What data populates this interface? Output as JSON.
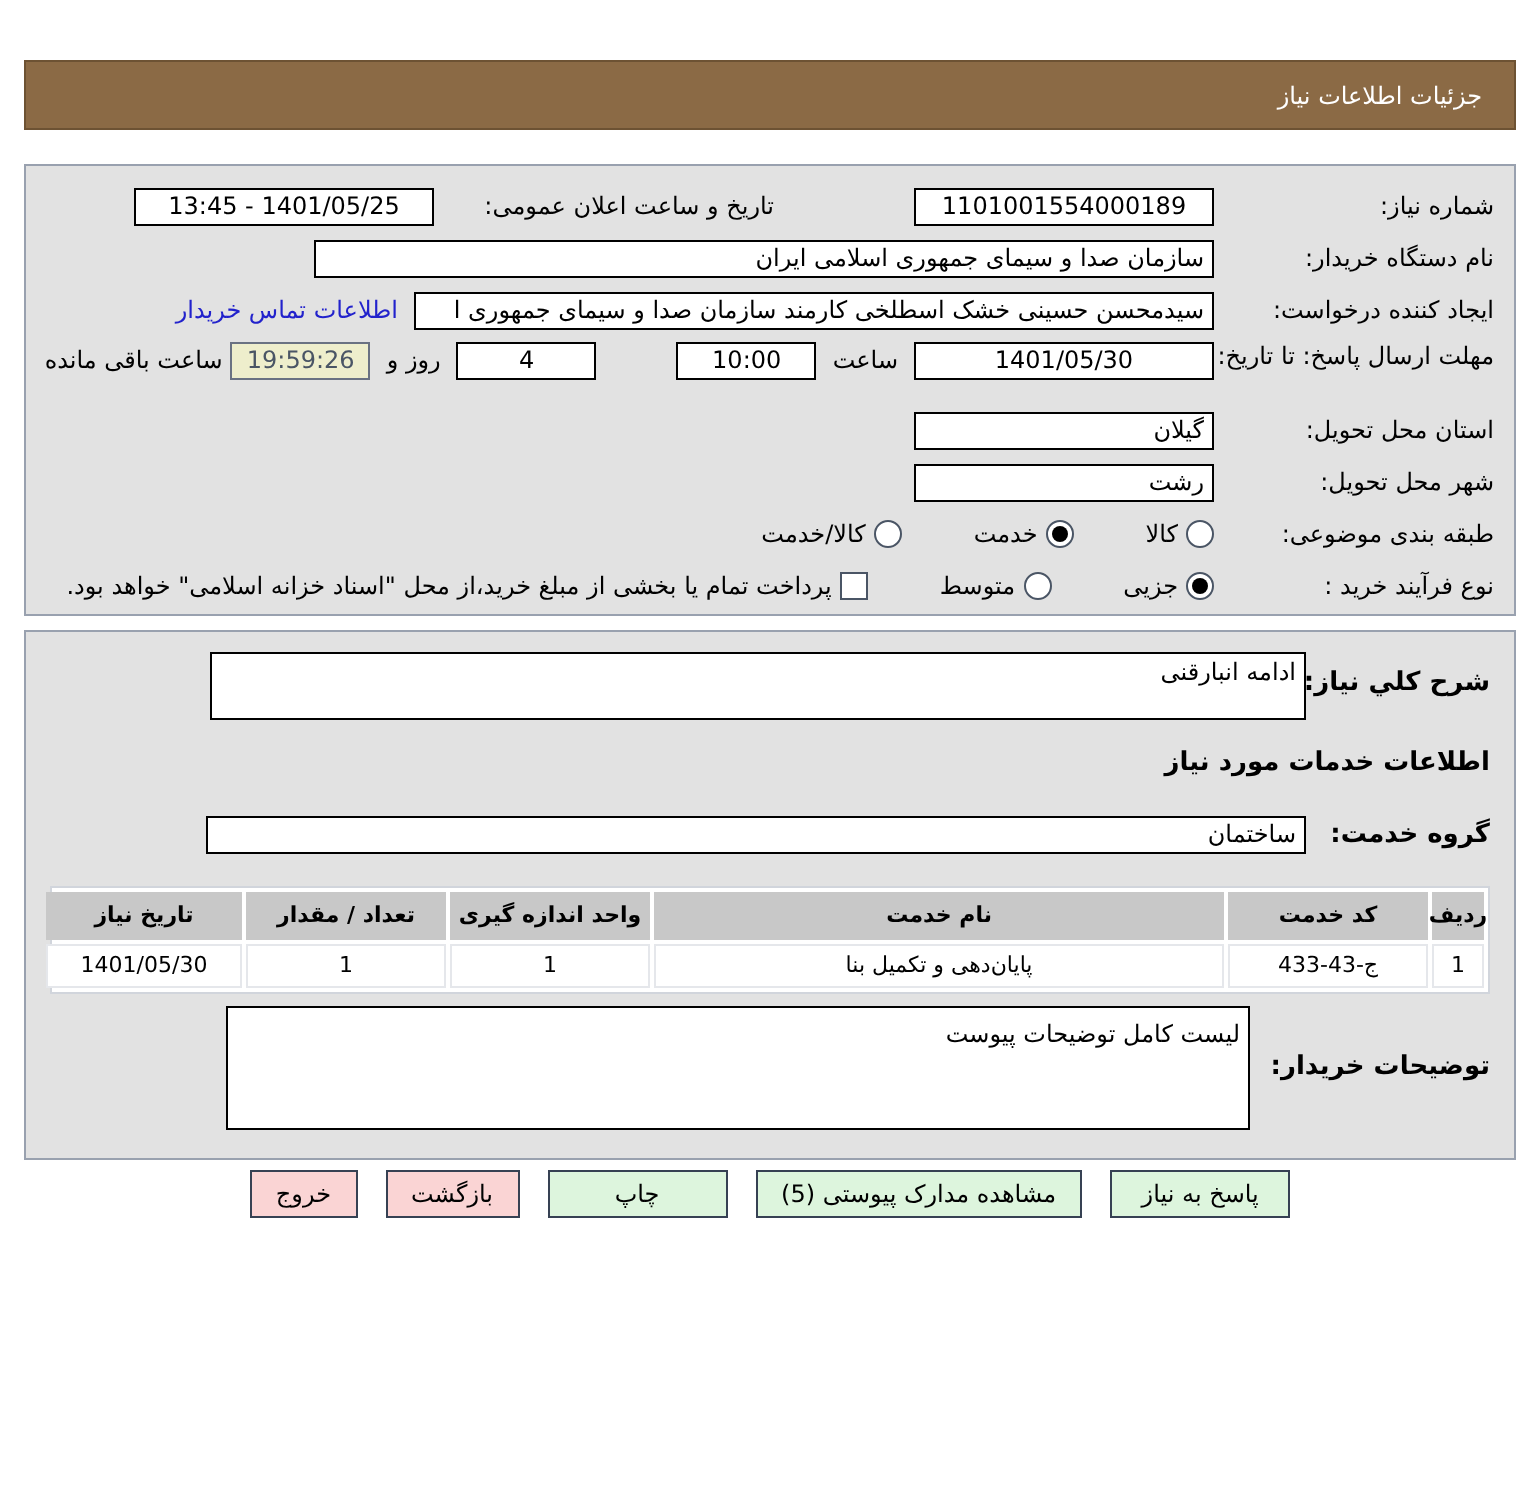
{
  "header": {
    "title": "جزئیات اطلاعات نیاز"
  },
  "need_number": {
    "label": "شماره نیاز:",
    "value": "1101001554000189"
  },
  "announce": {
    "label": "تاریخ و ساعت اعلان عمومی:",
    "value": "1401/05/25 - 13:45"
  },
  "buyer_org": {
    "label": "نام دستگاه خریدار:",
    "value": "سازمان صدا و سیمای جمهوری اسلامی ایران"
  },
  "creator": {
    "label": "ایجاد کننده درخواست:",
    "value": "سیدمحسن حسینی خشک اسطلخی کارمند سازمان صدا و سیمای جمهوری ا",
    "link": "اطلاعات تماس خریدار"
  },
  "deadline": {
    "label": "مهلت ارسال پاسخ: تا تاریخ:",
    "date": "1401/05/30",
    "time_label": "ساعت",
    "time": "10:00",
    "days": "4",
    "days_label": "روز و",
    "remaining": "19:59:26",
    "remaining_label": "ساعت باقی مانده"
  },
  "province": {
    "label": "استان محل تحویل:",
    "value": "گیلان"
  },
  "city": {
    "label": "شهر محل تحویل:",
    "value": "رشت"
  },
  "category": {
    "label": "طبقه بندی موضوعی:",
    "options": [
      {
        "label": "کالا",
        "selected": false
      },
      {
        "label": "خدمت",
        "selected": true
      },
      {
        "label": "کالا/خدمت",
        "selected": false
      }
    ]
  },
  "purchase_type": {
    "label": "نوع فرآیند خرید :",
    "options": [
      {
        "label": "جزیی",
        "selected": true
      },
      {
        "label": "متوسط",
        "selected": false
      }
    ],
    "payment": {
      "label": "پرداخت تمام یا بخشی از مبلغ خرید،از محل \"اسناد خزانه اسلامی\" خواهد بود.",
      "checked": false
    }
  },
  "summary": {
    "label": "شرح کلي نياز:",
    "value": "ادامه انبارقنی"
  },
  "services_title": "اطلاعات خدمات مورد نياز",
  "service_group": {
    "label": "گروه خدمت:",
    "value": "ساختمان"
  },
  "table": {
    "columns": [
      "رديف",
      "کد خدمت",
      "نام خدمت",
      "واحد اندازه گیری",
      "تعداد / مقدار",
      "تاریخ نیاز"
    ],
    "rows": [
      [
        "1",
        "ج-43-433",
        "پایان‌دهی و تکمیل بنا",
        "1",
        "1",
        "1401/05/30"
      ]
    ]
  },
  "buyer_notes": {
    "label": "توضیحات خریدار:",
    "value": "لیست کامل توضیحات پیوست"
  },
  "buttons": [
    {
      "label": "پاسخ به نیاز",
      "kind": "normal"
    },
    {
      "label": "مشاهده مدارک پیوستی (5)",
      "kind": "normal"
    },
    {
      "label": "چاپ",
      "kind": "normal"
    },
    {
      "label": "بازگشت",
      "kind": "danger"
    },
    {
      "label": "خروج",
      "kind": "danger"
    }
  ]
}
